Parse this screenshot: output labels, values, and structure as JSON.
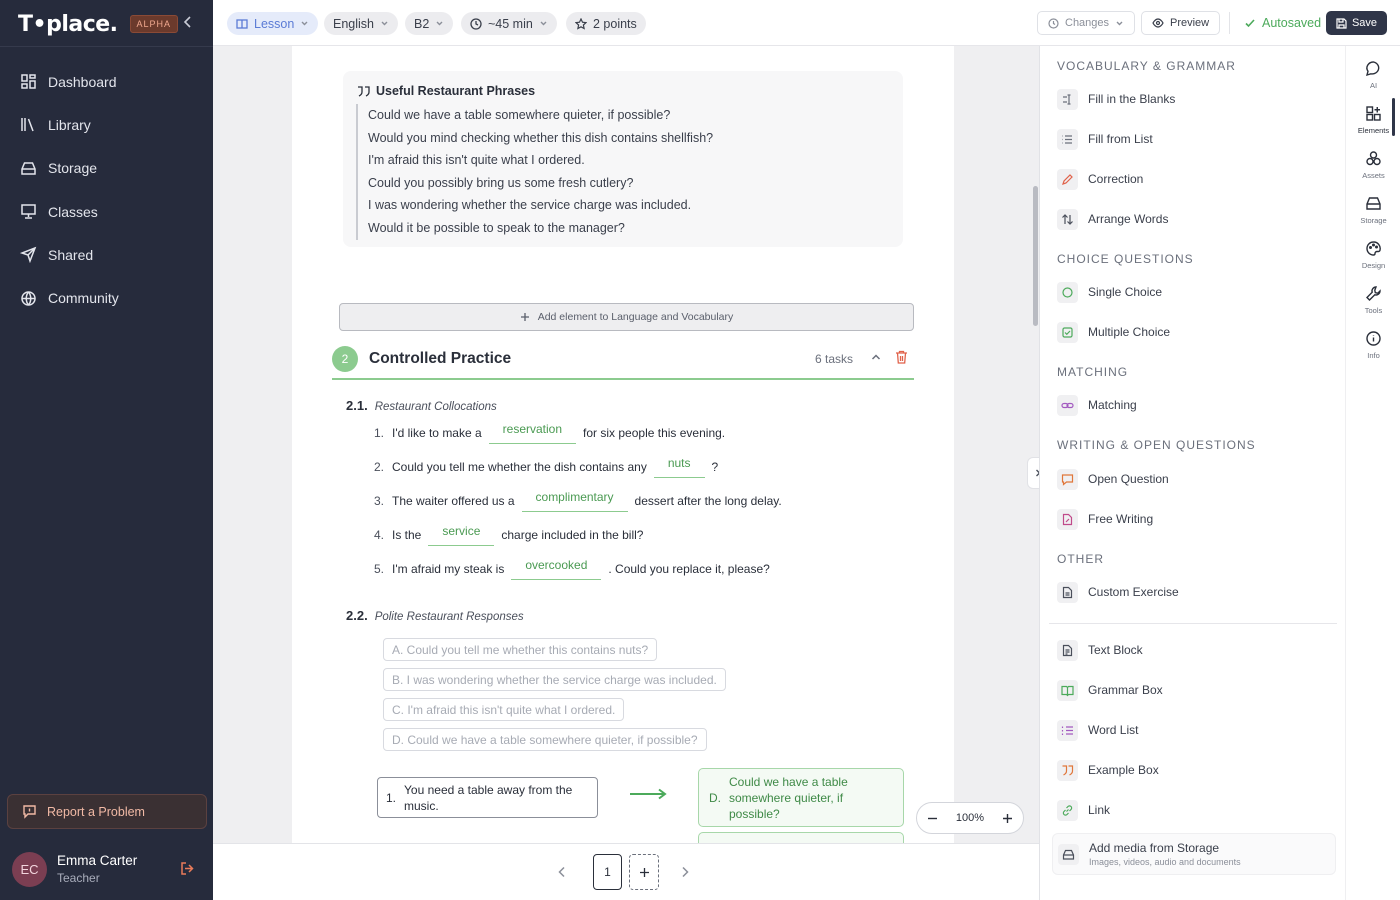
{
  "brand": {
    "logo": "T•place.",
    "badge": "ALPHA"
  },
  "nav": [
    {
      "label": "Dashboard",
      "icon": "dashboard-icon"
    },
    {
      "label": "Library",
      "icon": "library-icon"
    },
    {
      "label": "Storage",
      "icon": "storage-icon"
    },
    {
      "label": "Classes",
      "icon": "classes-icon"
    },
    {
      "label": "Shared",
      "icon": "shared-icon"
    },
    {
      "label": "Community",
      "icon": "globe-icon"
    }
  ],
  "report": {
    "label": "Report a Problem"
  },
  "user": {
    "initials": "EC",
    "name": "Emma Carter",
    "role": "Teacher"
  },
  "topbar": {
    "type": "Lesson",
    "language": "English",
    "level": "B2",
    "duration": "~45 min",
    "points": "2 points",
    "changes": "Changes",
    "preview": "Preview",
    "autosaved": "Autosaved",
    "save": "Save"
  },
  "phrases": {
    "title": "Useful Restaurant Phrases",
    "items": [
      "Could we have a table somewhere quieter, if possible?",
      "Would you mind checking whether this dish contains shellfish?",
      "I'm afraid this isn't quite what I ordered.",
      "Could you possibly bring us some fresh cutlery?",
      "I was wondering whether the service charge was included.",
      "Would it be possible to speak to the manager?"
    ]
  },
  "add_element": {
    "label": "Add element to Language and Vocabulary"
  },
  "section": {
    "number": "2",
    "title": "Controlled Practice",
    "tasks": "6 tasks"
  },
  "ex1": {
    "number": "2.1.",
    "title": "Restaurant Collocations",
    "rows": [
      {
        "n": "1.",
        "before": "I'd like to make a",
        "answer": "reservation",
        "after": "for six people this evening."
      },
      {
        "n": "2.",
        "before": "Could you tell me whether the dish contains any",
        "answer": "nuts",
        "after": "?"
      },
      {
        "n": "3.",
        "before": "The waiter offered us a",
        "answer": "complimentary",
        "after": "dessert after the long delay."
      },
      {
        "n": "4.",
        "before": "Is the",
        "answer": "service",
        "after": "charge included in the bill?"
      },
      {
        "n": "5.",
        "before": "I'm afraid my steak is",
        "answer": "overcooked",
        "after": ". Could you replace it, please?"
      }
    ]
  },
  "ex2": {
    "number": "2.2.",
    "title": "Polite Restaurant Responses",
    "options": [
      "A. Could you tell me whether this contains nuts?",
      "B. I was wondering whether the service charge was included.",
      "C. I'm afraid this isn't quite what I ordered.",
      "D. Could we have a table somewhere quieter, if possible?"
    ],
    "pair": {
      "left_n": "1.",
      "left": "You need a table away from the music.",
      "right_letter": "D.",
      "right": "Could we have a table somewhere quieter, if possible?"
    }
  },
  "zoom": {
    "value": "100%"
  },
  "pager": {
    "page": "1"
  },
  "elements_panel": {
    "cat1": "VOCABULARY & GRAMMAR",
    "cat2": "CHOICE QUESTIONS",
    "cat3": "MATCHING",
    "cat4": "WRITING & OPEN QUESTIONS",
    "cat5": "OTHER",
    "items": {
      "fill_blanks": "Fill in the Blanks",
      "fill_list": "Fill from List",
      "correction": "Correction",
      "arrange": "Arrange Words",
      "single": "Single Choice",
      "multiple": "Multiple Choice",
      "matching": "Matching",
      "open": "Open Question",
      "free": "Free Writing",
      "custom": "Custom Exercise",
      "text_block": "Text Block",
      "grammar_box": "Grammar Box",
      "word_list": "Word List",
      "example_box": "Example Box",
      "link": "Link"
    },
    "media": {
      "title": "Add media from Storage",
      "sub": "Images, videos, audio and documents"
    }
  },
  "rail": {
    "ai": "AI",
    "elements": "Elements",
    "assets": "Assets",
    "storage": "Storage",
    "design": "Design",
    "tools": "Tools",
    "info": "Info"
  },
  "colors": {
    "accent_green": "#4caa5b",
    "sidebar": "#262b3c",
    "danger": "#e0624a",
    "save": "#2f3548"
  }
}
